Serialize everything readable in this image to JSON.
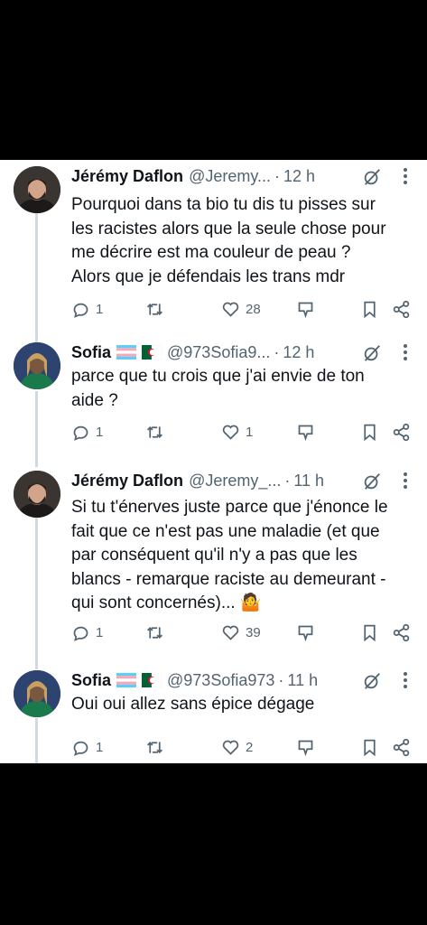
{
  "tweets": [
    {
      "author": "Jérémy Daflon",
      "handle": "@Jeremy...",
      "time": "12 h",
      "text": [
        "Pourquoi dans ta bio tu dis tu pisses sur",
        "les racistes alors que la seule chose pour",
        "me décrire est ma couleur de peau ?",
        "Alors que je défendais les trans mdr"
      ],
      "replies": "1",
      "retweets": "",
      "likes": "28"
    },
    {
      "author": "Sofia",
      "handle": "@973Sofia9...",
      "time": "12 h",
      "text": [
        "parce que tu crois que j'ai envie de ton",
        "aide ?"
      ],
      "replies": "1",
      "retweets": "",
      "likes": "1"
    },
    {
      "author": "Jérémy Daflon",
      "handle": "@Jeremy_...",
      "time": "11 h",
      "text": [
        "Si tu t'énerves juste parce que j'énonce le",
        "fait que ce n'est pas une maladie (et que",
        "par conséquent qu'il n'y a pas que les",
        "blancs - remarque raciste au demeurant -",
        "qui sont concernés)... 🤷"
      ],
      "replies": "1",
      "retweets": "",
      "likes": "39"
    },
    {
      "author": "Sofia",
      "handle": "@973Sofia973",
      "time": "11 h",
      "text": [
        "Oui oui allez sans épice dégage"
      ],
      "replies": "1",
      "retweets": "",
      "likes": "2"
    }
  ],
  "separator": "·",
  "colors": {
    "text": "#0f1419",
    "muted": "#536471",
    "line": "#cfd9de"
  }
}
